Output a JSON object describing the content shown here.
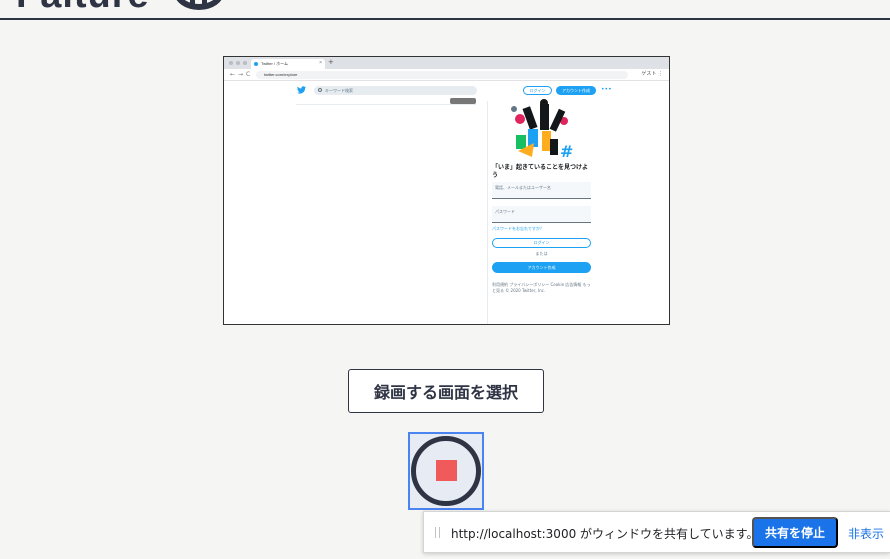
{
  "header": {
    "logo_text": "Falture"
  },
  "preview": {
    "tab_title": "Twitter / ホーム",
    "url": "twitter.com/explore",
    "toolbar_right": "ゲスト ⋮",
    "search_placeholder": "キーワード検索",
    "top_login": "ログイン",
    "top_signup": "アカウント作成",
    "headline": "「いま」起きていることを見つけよう",
    "input_user": "電話、メールまたはユーザー名",
    "input_password": "パスワード",
    "forgot_link": "パスワードをお忘れですか？",
    "login": "ログイン",
    "or": "または",
    "signup": "アカウント作成",
    "footer": "利用規約 プライバシーポリシー Cookie 広告情報 もっと見る © 2020 Twitter, Inc."
  },
  "select_button": "録画する画面を選択",
  "share_bar": {
    "message": "http://localhost:3000 がウィンドウを共有しています。",
    "stop": "共有を停止",
    "hide": "非表示"
  },
  "colors": {
    "primary": "#2f3444",
    "record": "#f15a5a",
    "twitter": "#1da1f2",
    "chrome_blue": "#1a73e8"
  }
}
